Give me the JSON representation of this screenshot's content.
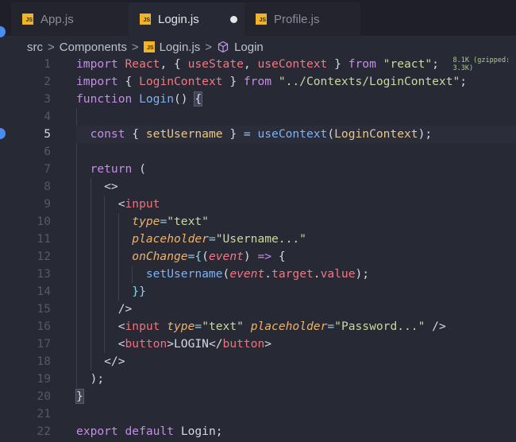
{
  "tabs": [
    {
      "label": "App.js",
      "icon": "js-file-icon"
    },
    {
      "label": "Login.js",
      "icon": "js-file-icon",
      "active": true,
      "unsaved": true
    },
    {
      "label": "Profile.js",
      "icon": "js-file-icon"
    }
  ],
  "breadcrumb": {
    "items": [
      "src",
      "Components",
      "Login.js",
      "Login"
    ],
    "separator": ">"
  },
  "icon_text": "JS",
  "current_line": 5,
  "lines": [
    [
      [
        "import ",
        "kw"
      ],
      [
        "React",
        "id"
      ],
      [
        ", { ",
        "pun"
      ],
      [
        "useState",
        "id"
      ],
      [
        ", ",
        "pun"
      ],
      [
        "useContext",
        "id"
      ],
      [
        " } ",
        "pun"
      ],
      [
        "from ",
        "kw"
      ],
      [
        "\"react\"",
        "str"
      ],
      [
        ";  ",
        "pun"
      ],
      [
        "8.1K (gzipped: 3.3K)",
        "hint"
      ]
    ],
    [
      [
        "import ",
        "kw"
      ],
      [
        "{ ",
        "pun"
      ],
      [
        "LoginContext",
        "id"
      ],
      [
        " } ",
        "pun"
      ],
      [
        "from ",
        "kw"
      ],
      [
        "\"../Contexts/LoginContext\"",
        "str"
      ],
      [
        ";",
        "pun"
      ]
    ],
    [
      [
        "function ",
        "kw"
      ],
      [
        "Login",
        "fn"
      ],
      [
        "() ",
        "pun"
      ],
      [
        "{",
        "bracket"
      ]
    ],
    [],
    [
      [
        "  const ",
        "kw"
      ],
      [
        "{ ",
        "pun"
      ],
      [
        "setUsername",
        "var"
      ],
      [
        " } ",
        "pun"
      ],
      [
        "= ",
        "op"
      ],
      [
        "useContext",
        "fn"
      ],
      [
        "(",
        "pun"
      ],
      [
        "LoginContext",
        "var"
      ],
      [
        ");",
        "pun"
      ]
    ],
    [],
    [
      [
        "  return ",
        "kw"
      ],
      [
        "(",
        "pun"
      ]
    ],
    [
      [
        "    <>",
        "pun"
      ]
    ],
    [
      [
        "      <",
        "pun"
      ],
      [
        "input",
        "tag"
      ]
    ],
    [
      [
        "        type",
        "attr"
      ],
      [
        "=",
        "op"
      ],
      [
        "\"text\"",
        "str"
      ]
    ],
    [
      [
        "        placeholder",
        "attr"
      ],
      [
        "=",
        "op"
      ],
      [
        "\"Username...\"",
        "str"
      ]
    ],
    [
      [
        "        onChange",
        "attr"
      ],
      [
        "={",
        "op"
      ],
      [
        "(",
        "pun"
      ],
      [
        "event",
        "param"
      ],
      [
        ") ",
        "pun"
      ],
      [
        "=> ",
        "kw"
      ],
      [
        "{",
        "pun"
      ]
    ],
    [
      [
        "          setUsername",
        "fn"
      ],
      [
        "(",
        "pun"
      ],
      [
        "event",
        "param"
      ],
      [
        ".",
        "pun"
      ],
      [
        "target",
        "prop"
      ],
      [
        ".",
        "pun"
      ],
      [
        "value",
        "prop"
      ],
      [
        ");",
        "pun"
      ]
    ],
    [
      [
        "        }}",
        "op"
      ]
    ],
    [
      [
        "      />",
        "pun"
      ]
    ],
    [
      [
        "      <",
        "pun"
      ],
      [
        "input ",
        "tag"
      ],
      [
        "type",
        "attr"
      ],
      [
        "=",
        "op"
      ],
      [
        "\"text\" ",
        "str"
      ],
      [
        "placeholder",
        "attr"
      ],
      [
        "=",
        "op"
      ],
      [
        "\"Password...\"",
        "str"
      ],
      [
        " />",
        "pun"
      ]
    ],
    [
      [
        "      <",
        "pun"
      ],
      [
        "button",
        "tag"
      ],
      [
        ">LOGIN</",
        "pun"
      ],
      [
        "button",
        "tag"
      ],
      [
        ">",
        "pun"
      ]
    ],
    [
      [
        "    </>",
        "pun"
      ]
    ],
    [
      [
        "  );",
        "pun"
      ]
    ],
    [
      [
        "}",
        "bracket"
      ]
    ],
    [],
    [
      [
        "export ",
        "kw"
      ],
      [
        "default ",
        "kw"
      ],
      [
        "Login",
        "pun"
      ],
      [
        ";",
        "pun"
      ]
    ]
  ]
}
